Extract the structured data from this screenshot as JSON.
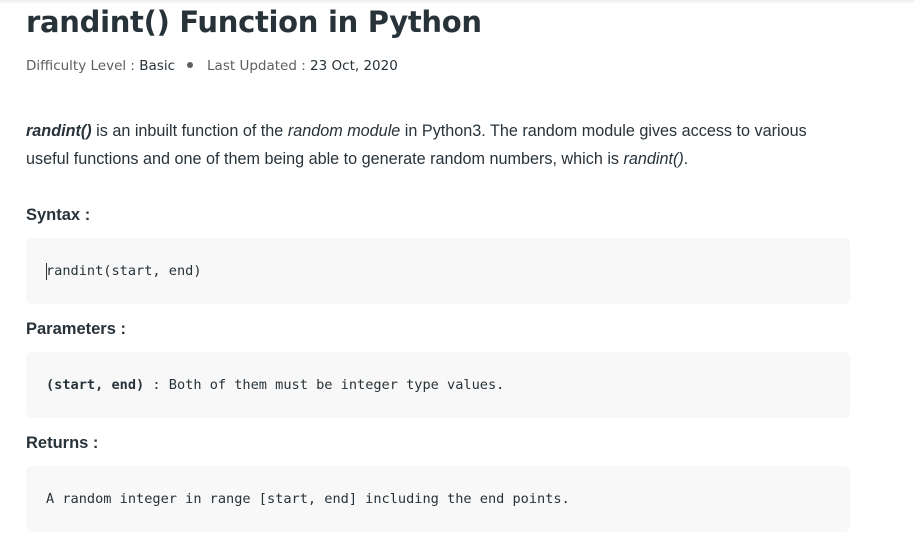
{
  "article": {
    "title": "randint() Function in Python",
    "meta": {
      "difficulty_label": "Difficulty Level : ",
      "difficulty_value": "Basic",
      "updated_label": "Last Updated : ",
      "updated_value": "23 Oct, 2020"
    },
    "intro": {
      "func_name": "randint()",
      "part1": " is an inbuilt function of the ",
      "module_name": "random module",
      "part2": " in Python3. The random module gives access to various useful functions and one of them being able to generate random numbers, which is ",
      "func_name_end": "randint()",
      "part3": "."
    },
    "syntax": {
      "label": "Syntax :",
      "code": "randint(start, end)"
    },
    "parameters": {
      "label": "Parameters :",
      "code_params": "(start, end)",
      "code_desc": " : Both of them must be integer type values."
    },
    "returns": {
      "label": "Returns :",
      "code": "A random integer in range [start, end] including the end points."
    }
  }
}
